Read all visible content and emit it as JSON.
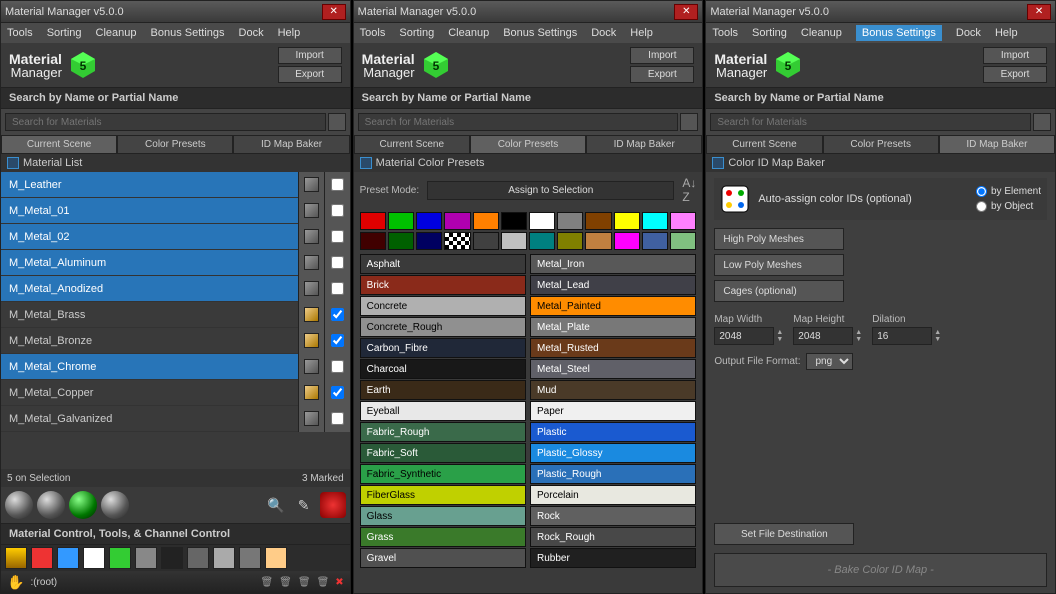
{
  "app_title": "Material Manager v5.0.0",
  "menu": [
    "Tools",
    "Sorting",
    "Cleanup",
    "Bonus Settings",
    "Dock",
    "Help"
  ],
  "logo": {
    "line1": "Material",
    "line2": "Manager",
    "badge": "5"
  },
  "io": {
    "import": "Import",
    "export": "Export"
  },
  "search": {
    "header": "Search by Name or Partial Name",
    "placeholder": "Search for Materials"
  },
  "tabs": [
    "Current Scene",
    "Color Presets",
    "ID Map Baker"
  ],
  "panel1": {
    "list_header": "Material List",
    "materials": [
      {
        "name": "M_Leather",
        "selected": true,
        "checked": false
      },
      {
        "name": "M_Metal_01",
        "selected": true,
        "checked": false
      },
      {
        "name": "M_Metal_02",
        "selected": true,
        "checked": false
      },
      {
        "name": "M_Metal_Aluminum",
        "selected": true,
        "checked": false
      },
      {
        "name": "M_Metal_Anodized",
        "selected": true,
        "checked": false
      },
      {
        "name": "M_Metal_Brass",
        "selected": false,
        "checked": true,
        "golden": true
      },
      {
        "name": "M_Metal_Bronze",
        "selected": false,
        "checked": true,
        "golden": true
      },
      {
        "name": "M_Metal_Chrome",
        "selected": true,
        "checked": false
      },
      {
        "name": "M_Metal_Copper",
        "selected": false,
        "checked": true,
        "golden": true
      },
      {
        "name": "M_Metal_Galvanized",
        "selected": false,
        "checked": false
      }
    ],
    "status_left": "5 on Selection",
    "status_right": "3 Marked",
    "control_header": "Material Control, Tools, & Channel Control",
    "root_label": ":(root)"
  },
  "panel2": {
    "header": "Material Color Presets",
    "preset_mode_label": "Preset Mode:",
    "preset_mode_value": "Assign to Selection",
    "swatches": [
      "#e00000",
      "#00c000",
      "#0000e0",
      "#b000b0",
      "#ff8000",
      "#000000",
      "#ffffff",
      "#808080",
      "#804000",
      "#ffff00",
      "#00ffff",
      "#ff80ff",
      "#400000",
      "#006000",
      "#000060",
      "#checker",
      "#404040",
      "#c0c0c0",
      "#008080",
      "#808000",
      "#c08040",
      "#ff00ff",
      "#4060a0",
      "#80c080"
    ],
    "col1": [
      {
        "label": "Asphalt",
        "bg": "#3a3a3a",
        "fg": "#fff"
      },
      {
        "label": "Brick",
        "bg": "#8a2a1a",
        "fg": "#fff"
      },
      {
        "label": "Concrete",
        "bg": "#b0b0b0",
        "fg": "#000"
      },
      {
        "label": "Concrete_Rough",
        "bg": "#909090",
        "fg": "#000"
      },
      {
        "label": "Carbon_Fibre",
        "bg": "#202838",
        "fg": "#fff"
      },
      {
        "label": "Charcoal",
        "bg": "#181818",
        "fg": "#fff"
      },
      {
        "label": "Earth",
        "bg": "#3a2a18",
        "fg": "#fff"
      },
      {
        "label": "Eyeball",
        "bg": "#e8e8e8",
        "fg": "#000"
      },
      {
        "label": "Fabric_Rough",
        "bg": "#3a6a4a",
        "fg": "#fff"
      },
      {
        "label": "Fabric_Soft",
        "bg": "#2a5a38",
        "fg": "#fff"
      },
      {
        "label": "Fabric_Synthetic",
        "bg": "#2aa048",
        "fg": "#000"
      },
      {
        "label": "FiberGlass",
        "bg": "#c0d000",
        "fg": "#000"
      },
      {
        "label": "Glass",
        "bg": "#68a090",
        "fg": "#000"
      },
      {
        "label": "Grass",
        "bg": "#3a7a2a",
        "fg": "#fff"
      },
      {
        "label": "Gravel",
        "bg": "#505050",
        "fg": "#fff"
      }
    ],
    "col2": [
      {
        "label": "Metal_Iron",
        "bg": "#585858",
        "fg": "#fff"
      },
      {
        "label": "Metal_Lead",
        "bg": "#404048",
        "fg": "#fff"
      },
      {
        "label": "Metal_Painted",
        "bg": "#ff8c00",
        "fg": "#000"
      },
      {
        "label": "Metal_Plate",
        "bg": "#787878",
        "fg": "#fff"
      },
      {
        "label": "Metal_Rusted",
        "bg": "#6a3a1a",
        "fg": "#fff"
      },
      {
        "label": "Metal_Steel",
        "bg": "#606068",
        "fg": "#fff"
      },
      {
        "label": "Mud",
        "bg": "#4a3a28",
        "fg": "#fff"
      },
      {
        "label": "Paper",
        "bg": "#f0f0f0",
        "fg": "#000"
      },
      {
        "label": "Plastic",
        "bg": "#1a5ad0",
        "fg": "#fff"
      },
      {
        "label": "Plastic_Glossy",
        "bg": "#1a8ae0",
        "fg": "#fff"
      },
      {
        "label": "Plastic_Rough",
        "bg": "#2a70b8",
        "fg": "#fff"
      },
      {
        "label": "Porcelain",
        "bg": "#e8e8e0",
        "fg": "#000"
      },
      {
        "label": "Rock",
        "bg": "#606060",
        "fg": "#fff"
      },
      {
        "label": "Rock_Rough",
        "bg": "#484848",
        "fg": "#fff"
      },
      {
        "label": "Rubber",
        "bg": "#202020",
        "fg": "#fff"
      }
    ]
  },
  "panel3": {
    "header": "Color ID Map Baker",
    "auto_label": "Auto-assign color IDs (optional)",
    "radio1": "by Element",
    "radio2": "by Object",
    "btn_high": "High Poly Meshes",
    "btn_low": "Low Poly Meshes",
    "btn_cages": "Cages (optional)",
    "map_width_label": "Map Width",
    "map_width": "2048",
    "map_height_label": "Map Height",
    "map_height": "2048",
    "dilation_label": "Dilation",
    "dilation": "16",
    "outfmt_label": "Output File Format:",
    "outfmt_value": "png",
    "setdest": "Set File Destination",
    "bake": "- Bake Color ID Map -"
  }
}
